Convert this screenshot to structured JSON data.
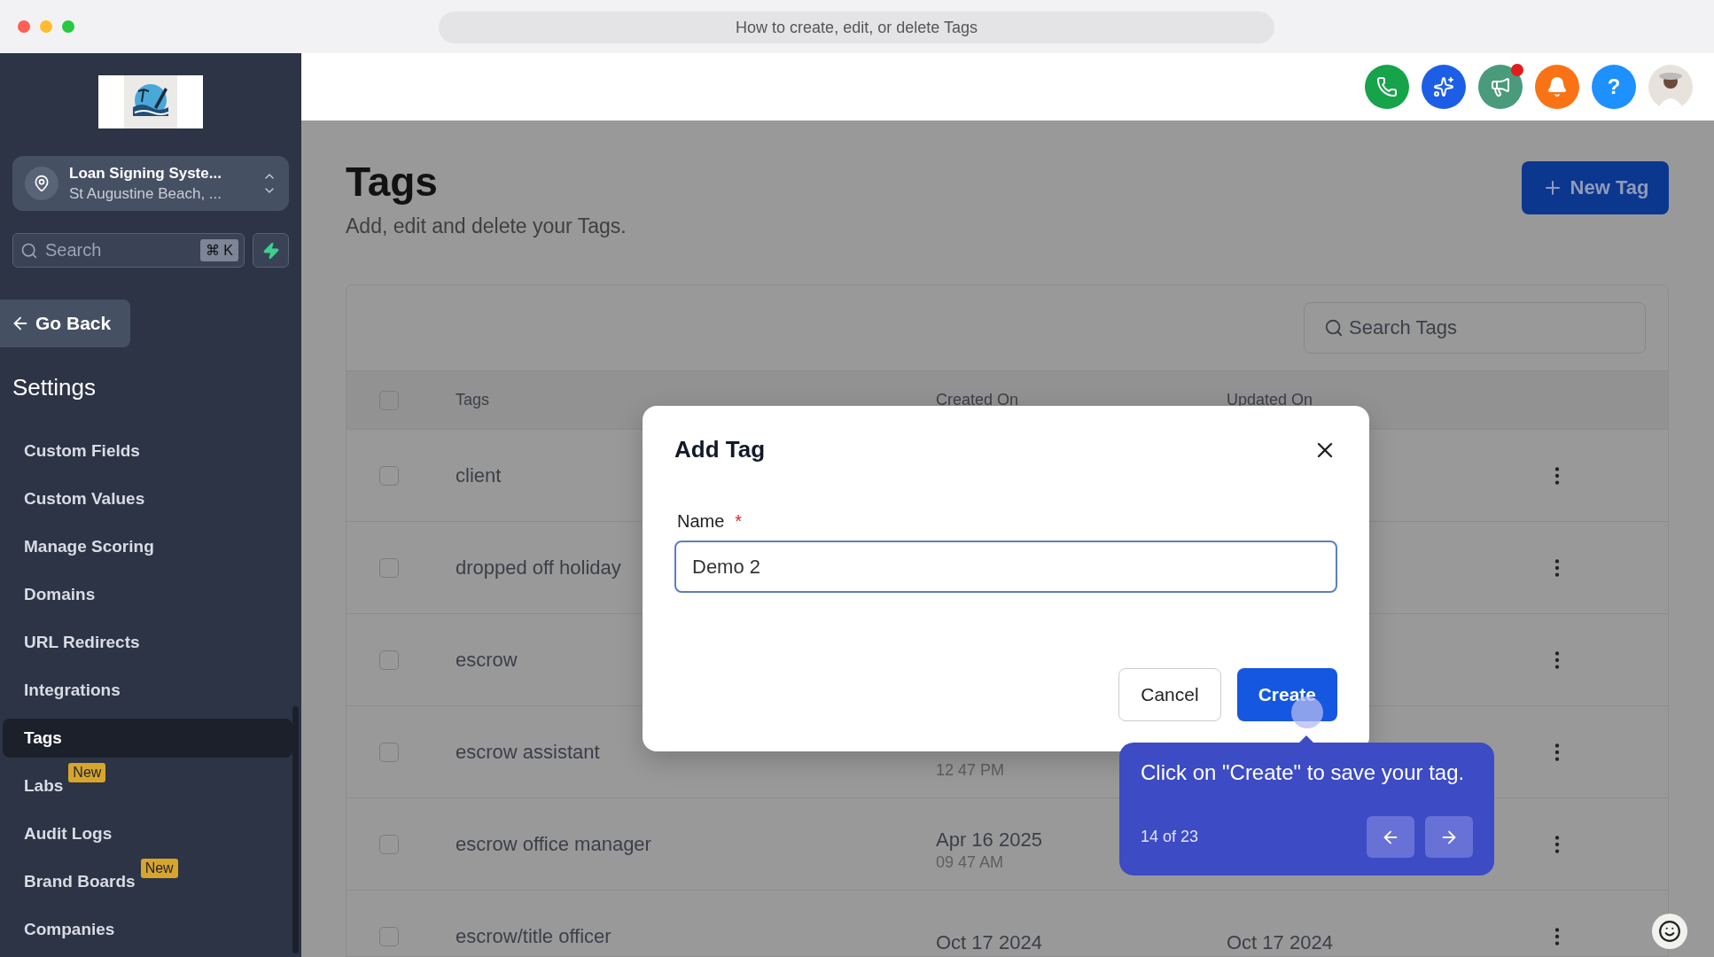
{
  "browser": {
    "title": "How to create, edit, or delete Tags"
  },
  "sidebar": {
    "location": {
      "name": "Loan Signing Syste...",
      "address": "St Augustine Beach, ..."
    },
    "search": {
      "placeholder": "Search",
      "shortcut": "⌘ K"
    },
    "back": "Go Back",
    "heading": "Settings",
    "items": [
      {
        "label": "Custom Fields",
        "selected": false
      },
      {
        "label": "Custom Values",
        "selected": false
      },
      {
        "label": "Manage Scoring",
        "selected": false
      },
      {
        "label": "Domains",
        "selected": false
      },
      {
        "label": "URL Redirects",
        "selected": false
      },
      {
        "label": "Integrations",
        "selected": false
      },
      {
        "label": "Tags",
        "selected": true
      },
      {
        "label": "Labs",
        "selected": false,
        "badge": "New"
      },
      {
        "label": "Audit Logs",
        "selected": false
      },
      {
        "label": "Brand Boards",
        "selected": false,
        "badge": "New"
      },
      {
        "label": "Companies",
        "selected": false
      }
    ]
  },
  "header": {
    "icons": [
      {
        "kind": "phone",
        "color": "#16a34a",
        "unread": false
      },
      {
        "kind": "sparkle",
        "color": "#1d5ee6",
        "unread": false
      },
      {
        "kind": "megaphone",
        "color": "#4a9a7c",
        "unread": true
      },
      {
        "kind": "bell",
        "color": "#f97316",
        "unread": false
      },
      {
        "kind": "help",
        "color": "#1e90ff",
        "unread": false,
        "glyph": "?"
      },
      {
        "kind": "avatar",
        "color": "#e8e2dc",
        "unread": false
      }
    ]
  },
  "page": {
    "title": "Tags",
    "subtitle": "Add, edit and delete your Tags.",
    "new_button": "New Tag"
  },
  "table": {
    "search_placeholder": "Search Tags",
    "select_all_checked": false,
    "columns": [
      "Tags",
      "Created On",
      "Updated On"
    ],
    "rows": [
      {
        "tag": "client",
        "checked": false
      },
      {
        "tag": "dropped off holiday",
        "checked": false
      },
      {
        "tag": "escrow",
        "checked": false
      },
      {
        "tag": "escrow assistant",
        "checked": false,
        "created": {
          "time": "12 47 PM"
        }
      },
      {
        "tag": "escrow office manager",
        "checked": false,
        "created": {
          "date": "Apr 16 2025",
          "time": "09 47 AM"
        }
      },
      {
        "tag": "escrow/title officer",
        "checked": false,
        "created": {
          "date": "Oct 17 2024"
        },
        "updated": {
          "date": "Oct 17 2024"
        }
      }
    ]
  },
  "modal": {
    "title": "Add Tag",
    "field_label": "Name",
    "required_mark": "*",
    "value": "Demo 2",
    "buttons": [
      {
        "label": "Cancel",
        "kind": "secondary"
      },
      {
        "label": "Create",
        "kind": "primary"
      }
    ]
  },
  "tooltip": {
    "text": "Click on \"Create\" to save your tag.",
    "step": "14 of 23"
  }
}
